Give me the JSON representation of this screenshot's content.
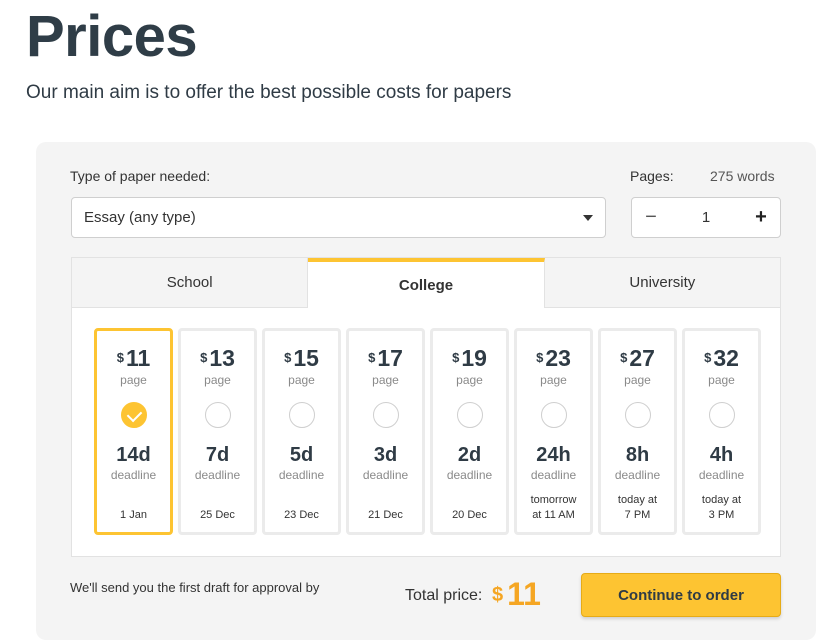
{
  "header": {
    "title": "Prices",
    "subtitle": "Our main aim is to offer the best possible costs for papers"
  },
  "form": {
    "type_label": "Type of paper needed:",
    "type_value": "Essay (any type)",
    "pages_label": "Pages:",
    "words": "275 words",
    "minus": "−",
    "plus": "+",
    "pages_value": "1"
  },
  "tabs": [
    {
      "label": "School",
      "active": false
    },
    {
      "label": "College",
      "active": true
    },
    {
      "label": "University",
      "active": false
    }
  ],
  "currency": "$",
  "unit_label": "page",
  "deadline_label": "deadline",
  "options": [
    {
      "price": "11",
      "duration": "14d",
      "date": "1 Jan",
      "selected": true
    },
    {
      "price": "13",
      "duration": "7d",
      "date": "25 Dec",
      "selected": false
    },
    {
      "price": "15",
      "duration": "5d",
      "date": "23 Dec",
      "selected": false
    },
    {
      "price": "17",
      "duration": "3d",
      "date": "21 Dec",
      "selected": false
    },
    {
      "price": "19",
      "duration": "2d",
      "date": "20 Dec",
      "selected": false
    },
    {
      "price": "23",
      "duration": "24h",
      "date_line1": "tomorrow",
      "date_line2": "at 11 AM",
      "selected": false
    },
    {
      "price": "27",
      "duration": "8h",
      "date_line1": "today at",
      "date_line2": "7 PM",
      "selected": false
    },
    {
      "price": "32",
      "duration": "4h",
      "date_line1": "today at",
      "date_line2": "3 PM",
      "selected": false
    }
  ],
  "footer": {
    "draft_text": "We'll send you the first draft for approval by",
    "total_label": "Total price:",
    "total_currency": "$",
    "total_value": "11",
    "cta_label": "Continue to order"
  },
  "colors": {
    "accent": "#fdc432",
    "total": "#f5a623",
    "title": "#2f3d47"
  }
}
